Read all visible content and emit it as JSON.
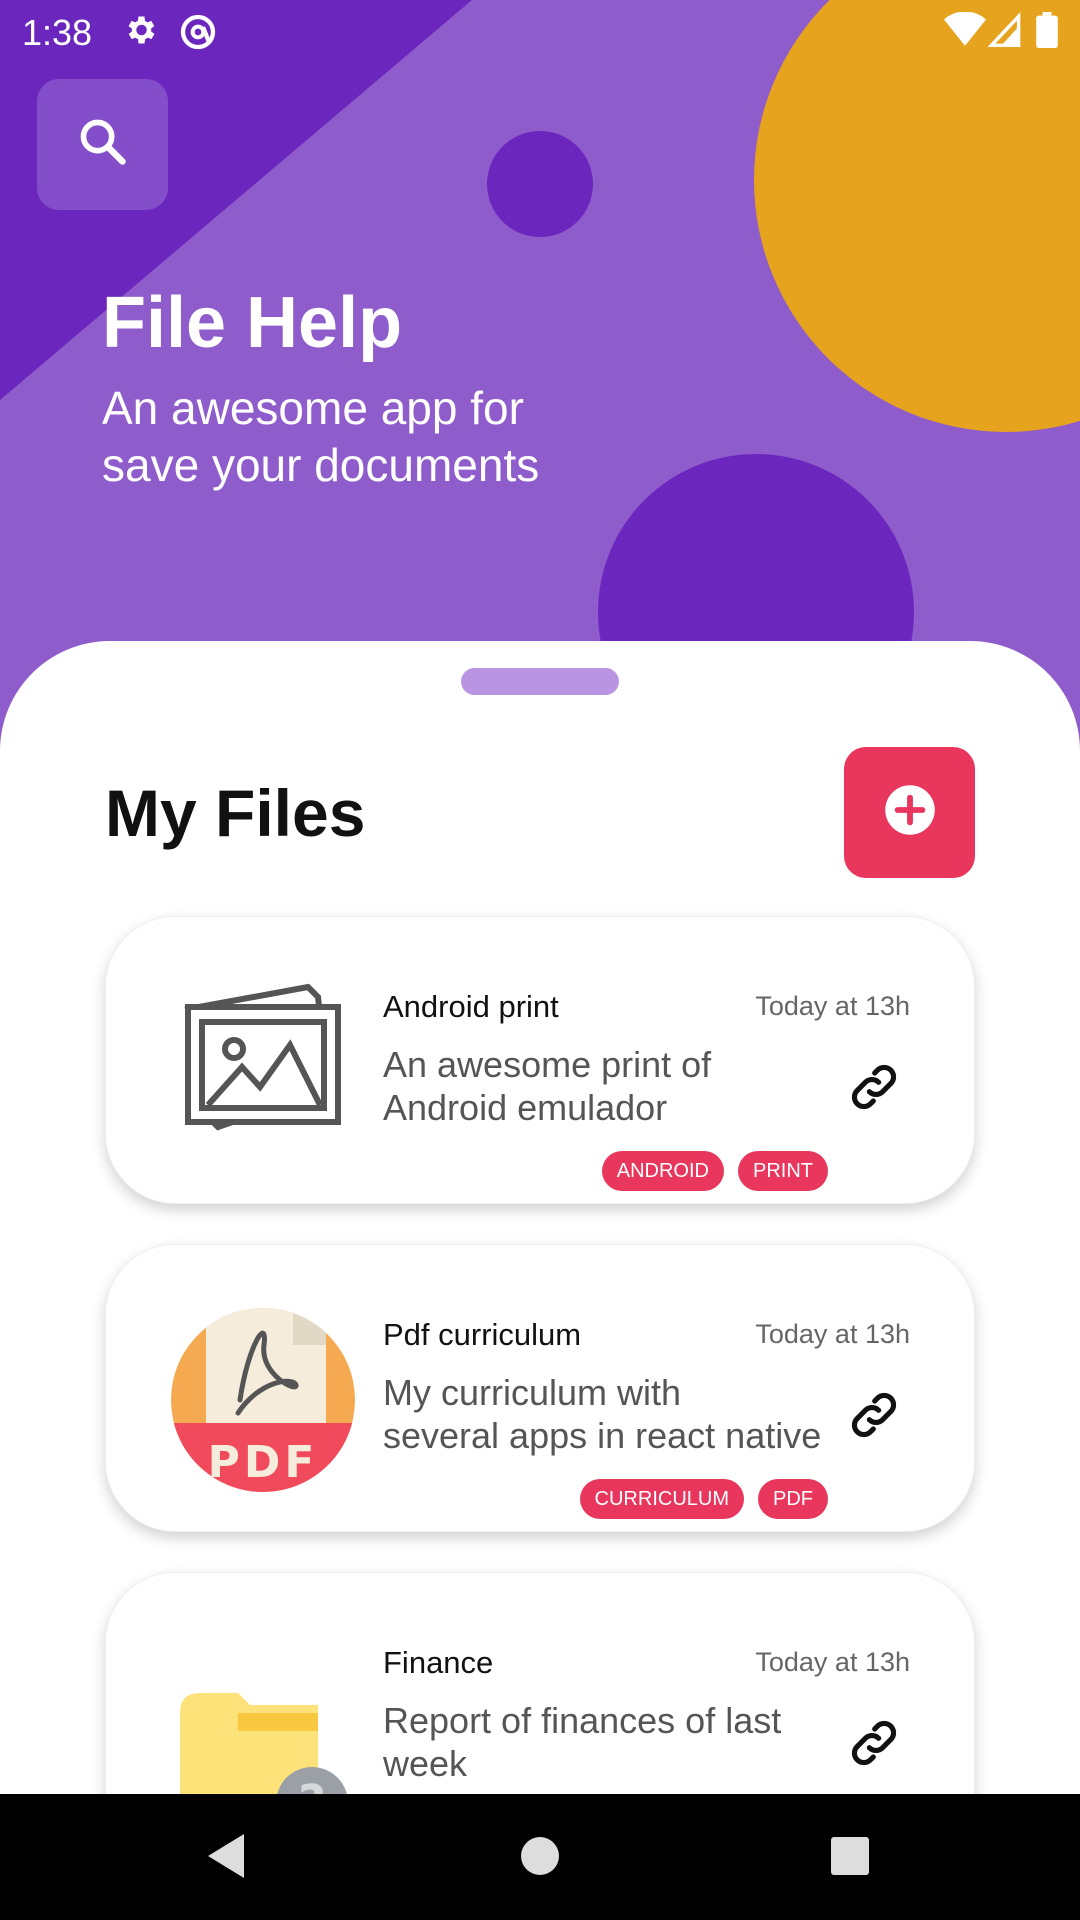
{
  "status_bar": {
    "time": "1:38"
  },
  "header": {
    "title": "File Help",
    "subtitle": "An awesome app for save your documents"
  },
  "colors": {
    "hero": "#8f5ccb",
    "hero_dark": "#6a26bd",
    "accent_circle": "#e6a41e",
    "accent": "#e8365d",
    "handle": "#b894e2"
  },
  "files_section": {
    "title": "My Files",
    "items": [
      {
        "icon": "image-file-icon",
        "name": "Android print",
        "time": "Today at 13h",
        "description": "An awesome print of Android emulador",
        "tags": [
          "ANDROID",
          "PRINT"
        ]
      },
      {
        "icon": "pdf-file-icon",
        "name": "Pdf curriculum",
        "time": "Today at 13h",
        "description": "My curriculum with several apps in react native",
        "tags": [
          "CURRICULUM",
          "PDF"
        ]
      },
      {
        "icon": "unknown-folder-icon",
        "name": "Finance",
        "time": "Today at 13h",
        "description": "Report of finances of last week",
        "tags": []
      }
    ]
  }
}
